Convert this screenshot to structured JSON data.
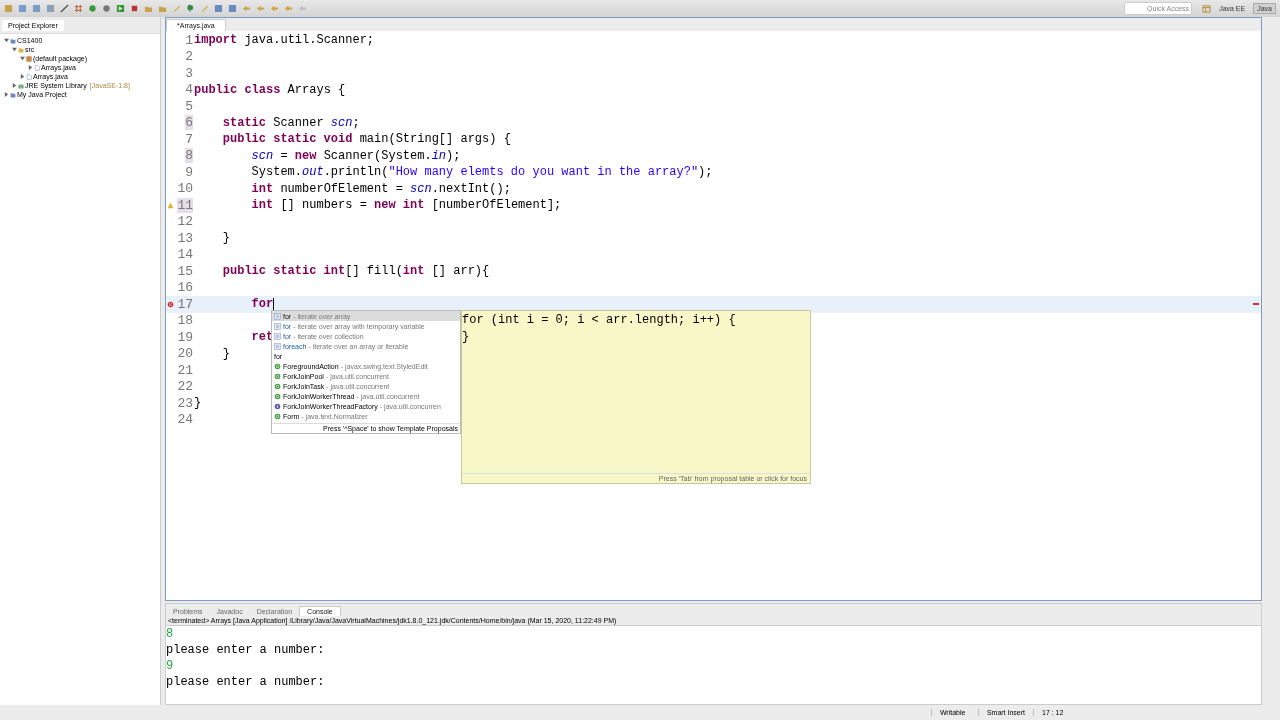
{
  "toolbar": {
    "quick_access": {
      "placeholder": "Quick Access"
    },
    "perspectives": [
      {
        "label": "Java EE",
        "selected": false
      },
      {
        "label": "Java",
        "selected": true
      }
    ]
  },
  "project_explorer": {
    "title": "Project Explorer",
    "tree": [
      {
        "label": "CS1400",
        "kind": "project",
        "expanded": true,
        "children": [
          {
            "label": "src",
            "kind": "folder",
            "expanded": true,
            "children": [
              {
                "label": "(default package)",
                "kind": "package",
                "expanded": true,
                "children": [
                  {
                    "label": "Arrays.java",
                    "kind": "file",
                    "expanded": false
                  }
                ]
              },
              {
                "label": "Arrays.java",
                "kind": "file",
                "expanded": false
              }
            ]
          },
          {
            "label": "JRE System Library",
            "decoration": "[JavaSE-1.8]",
            "kind": "library",
            "expanded": false
          }
        ]
      },
      {
        "label": "My Java Project",
        "kind": "project",
        "expanded": false
      }
    ]
  },
  "editor": {
    "tabs": [
      {
        "label": "*Arrays.java",
        "selected": true
      }
    ],
    "lines": [
      {
        "n": "1",
        "highlighted": false,
        "current": false,
        "tokens": [
          {
            "kind": "keyword",
            "t": "import"
          },
          {
            "kind": "plain",
            "t": " java.util.Scanner;"
          }
        ]
      },
      {
        "n": "2",
        "highlighted": false,
        "current": false
      },
      {
        "n": "3",
        "highlighted": false,
        "current": false
      },
      {
        "n": "4",
        "highlighted": false,
        "current": false,
        "tokens": [
          {
            "kind": "keyword",
            "t": "public class"
          },
          {
            "kind": "plain",
            "t": " Arrays {"
          }
        ]
      },
      {
        "n": "5",
        "highlighted": false,
        "current": false
      },
      {
        "n": "6",
        "highlighted": true,
        "current": false,
        "tokens": [
          {
            "kind": "keyword",
            "t": "    static"
          },
          {
            "kind": "plain",
            "t": " Scanner "
          },
          {
            "kind": "field",
            "t": "scn"
          },
          {
            "kind": "plain",
            "t": ";"
          }
        ]
      },
      {
        "n": "7",
        "highlighted": false,
        "current": false,
        "tokens": [
          {
            "kind": "keyword",
            "t": "    public static void"
          },
          {
            "kind": "plain",
            "t": " main(String[] args) {"
          }
        ]
      },
      {
        "n": "8",
        "highlighted": true,
        "current": false,
        "tokens": [
          {
            "kind": "field",
            "t": "        scn"
          },
          {
            "kind": "plain",
            "t": " = "
          },
          {
            "kind": "keyword",
            "t": "new"
          },
          {
            "kind": "plain",
            "t": " Scanner(System."
          },
          {
            "kind": "field",
            "t": "in"
          },
          {
            "kind": "plain",
            "t": ");"
          }
        ]
      },
      {
        "n": "9",
        "highlighted": false,
        "current": false,
        "tokens": [
          {
            "kind": "plain",
            "t": "        System."
          },
          {
            "kind": "field",
            "t": "out"
          },
          {
            "kind": "plain",
            "t": ".println("
          },
          {
            "kind": "string",
            "t": "\"How many elemts do you want in the array?\""
          },
          {
            "kind": "plain",
            "t": ");"
          }
        ]
      },
      {
        "n": "10",
        "highlighted": false,
        "current": false,
        "tokens": [
          {
            "kind": "keyword",
            "t": "        int"
          },
          {
            "kind": "plain",
            "t": " numberOfElement = "
          },
          {
            "kind": "field",
            "t": "scn"
          },
          {
            "kind": "plain",
            "t": ".nextInt();"
          }
        ]
      },
      {
        "n": "11",
        "highlighted": true,
        "current": false,
        "kind": "warning",
        "tokens": [
          {
            "kind": "keyword",
            "t": "        int"
          },
          {
            "kind": "plain",
            "t": " [] numbers = "
          },
          {
            "kind": "keyword",
            "t": "new int"
          },
          {
            "kind": "plain",
            "t": " [numberOfElement];"
          }
        ]
      },
      {
        "n": "12",
        "highlighted": false,
        "current": false
      },
      {
        "n": "13",
        "highlighted": false,
        "current": false,
        "tokens": [
          {
            "kind": "plain",
            "t": "    }"
          }
        ]
      },
      {
        "n": "14",
        "highlighted": false,
        "current": false
      },
      {
        "n": "15",
        "highlighted": false,
        "current": false,
        "tokens": [
          {
            "kind": "keyword",
            "t": "    public static int"
          },
          {
            "kind": "plain",
            "t": "[] fill("
          },
          {
            "kind": "keyword",
            "t": "int"
          },
          {
            "kind": "plain",
            "t": " [] arr){"
          }
        ]
      },
      {
        "n": "16",
        "highlighted": false,
        "current": false
      },
      {
        "n": "17",
        "highlighted": false,
        "current": true,
        "kind": "error",
        "tokens": [
          {
            "kind": "keyword",
            "t": "        for"
          }
        ]
      },
      {
        "n": "18",
        "highlighted": false,
        "current": false
      },
      {
        "n": "19",
        "highlighted": false,
        "current": false,
        "tokens": [
          {
            "kind": "keyword",
            "t": "        ret"
          }
        ]
      },
      {
        "n": "20",
        "highlighted": false,
        "current": false,
        "tokens": [
          {
            "kind": "plain",
            "t": "    }"
          }
        ]
      },
      {
        "n": "21",
        "highlighted": false,
        "current": false
      },
      {
        "n": "22",
        "highlighted": false,
        "current": false
      },
      {
        "n": "23",
        "highlighted": false,
        "current": false,
        "tokens": [
          {
            "kind": "plain",
            "t": "}"
          }
        ]
      },
      {
        "n": "24",
        "highlighted": false,
        "current": false
      }
    ]
  },
  "content_assist": {
    "proposals": [
      {
        "kind": "template",
        "name": "for",
        "detail": "- iterate over array",
        "selected": true
      },
      {
        "kind": "template",
        "name": "for",
        "detail": "- iterate over array with temporary variable",
        "selected": false
      },
      {
        "kind": "template",
        "name": "for",
        "detail": "- iterate over collection",
        "selected": false
      },
      {
        "kind": "template",
        "name": "foreach",
        "detail": "- iterate over an array or iterable",
        "selected": false
      },
      {
        "kind": "heading",
        "name": "for",
        "selected": false
      },
      {
        "kind": "class",
        "name": "ForegroundAction",
        "detail": "- javax.swing.text.StyledEdit",
        "selected": false
      },
      {
        "kind": "class",
        "name": "ForkJoinPool",
        "detail": "- java.util.concurrent",
        "selected": false
      },
      {
        "kind": "class",
        "name": "ForkJoinTask",
        "detail": "- java.util.concurrent",
        "selected": false
      },
      {
        "kind": "class",
        "name": "ForkJoinWorkerThread",
        "detail": "- java.util.concurrent",
        "selected": false
      },
      {
        "kind": "interface",
        "name": "ForkJoinWorkerThreadFactory",
        "detail": "- java.util.concurren",
        "selected": false
      },
      {
        "kind": "class",
        "name": "Form",
        "detail": "- java.text.Normalizer",
        "selected": false
      }
    ],
    "footer": "Press '^Space' to show Template Proposals",
    "preview": [
      "for (int i = 0; i < arr.length; i++) {",
      "}"
    ],
    "preview_footer": "Press 'Tab' from proposal table or click for focus"
  },
  "console": {
    "tabs": [
      {
        "label": "Problems",
        "selected": false
      },
      {
        "label": "Javadoc",
        "selected": false
      },
      {
        "label": "Declaration",
        "selected": false
      },
      {
        "label": "Console",
        "selected": true
      }
    ],
    "header": "<terminated> Arrays [Java Application] /Library/Java/JavaVirtualMachines/jdk1.8.0_121.jdk/Contents/Home/bin/java (Mar 15, 2020, 11:22:49 PM)",
    "lines": [
      {
        "kind": "input",
        "text": "8"
      },
      {
        "kind": "output",
        "text": "please enter a number:"
      },
      {
        "kind": "input",
        "text": "9"
      },
      {
        "kind": "output",
        "text": "please enter a number:"
      }
    ]
  },
  "status_bar": [
    "Writable",
    "Smart Insert",
    "17 : 12"
  ]
}
